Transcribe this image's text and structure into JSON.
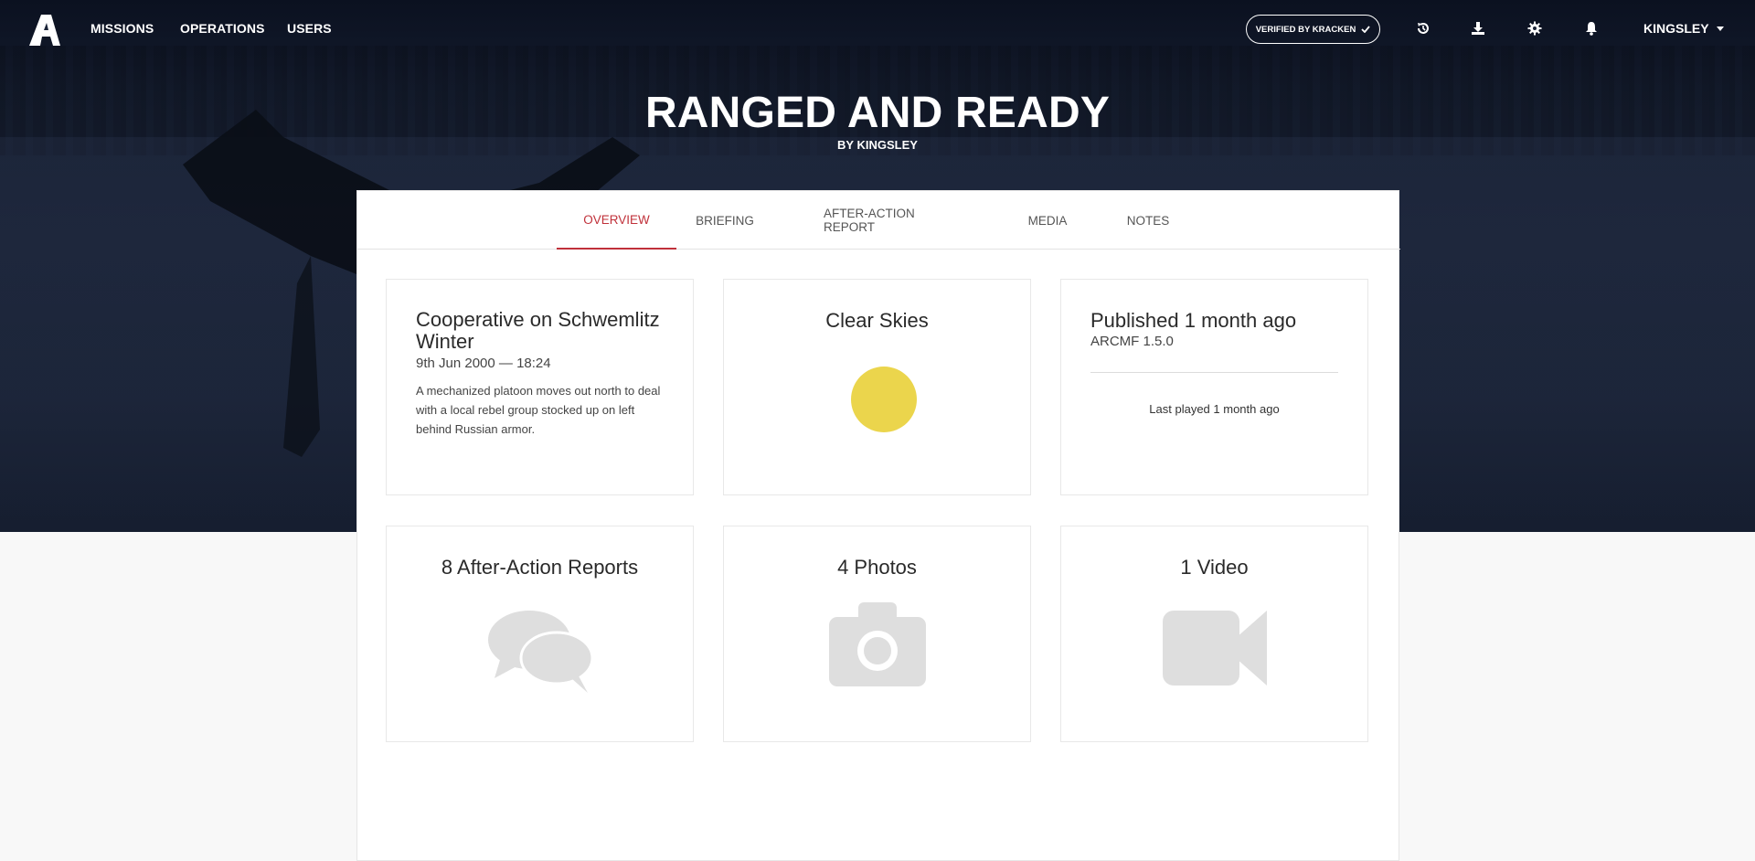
{
  "nav": {
    "links": [
      "MISSIONS",
      "OPERATIONS",
      "USERS"
    ],
    "verified_label": "VERIFIED BY KRACKEN",
    "icons": [
      "history-icon",
      "download-icon",
      "settings-icon",
      "bell-icon"
    ],
    "user": "KINGSLEY"
  },
  "mission": {
    "title": "RANGED AND READY",
    "author": "BY KINGSLEY"
  },
  "tabs": [
    "OVERVIEW",
    "BRIEFING",
    "AFTER-ACTION REPORT",
    "MEDIA",
    "NOTES"
  ],
  "active_tab": "OVERVIEW",
  "cards": {
    "summary": {
      "heading": "Cooperative on Schwemlitz Winter",
      "datetime": "9th Jun 2000 — 18:24",
      "description": "A mechanized platoon moves out north to deal with a local rebel group stocked up on left behind Russian armor."
    },
    "weather": {
      "heading": "Clear Skies",
      "icon": "sun-icon",
      "color": "#ebd54c"
    },
    "publish": {
      "heading": "Published 1 month ago",
      "framework": "ARCMF 1.5.0",
      "last_played": "Last played 1 month ago"
    },
    "reports": {
      "heading": "8 After-Action Reports",
      "icon": "comments-icon"
    },
    "photos": {
      "heading": "4 Photos",
      "icon": "camera-icon"
    },
    "videos": {
      "heading": "1 Video",
      "icon": "video-camera-icon"
    }
  },
  "colors": {
    "accent": "#c0313a",
    "hero_bg": "#1b2438",
    "icon_gray": "#dedede"
  }
}
